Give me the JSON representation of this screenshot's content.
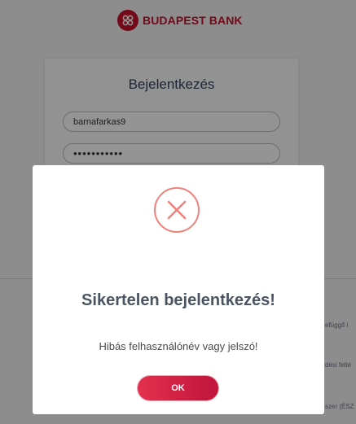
{
  "brand": {
    "name": "BUDAPEST BANK",
    "color": "#c8102e",
    "logo_icon": "budapest-bank-emblem-icon"
  },
  "login": {
    "title": "Bejelentkezés",
    "username_value": "barnafarkas9",
    "password_value": "•••••••••••"
  },
  "footer": {
    "links": [
      "efüggő i",
      "dési felté",
      "szer (ÉSZ"
    ]
  },
  "dialog": {
    "icon": "error-x-icon",
    "accent_color": "#f0817a",
    "title": "Sikertelen bejelentkezés!",
    "message": "Hibás felhasználónév vagy jelszó!",
    "ok_label": "OK",
    "button_color": "#d42147"
  }
}
